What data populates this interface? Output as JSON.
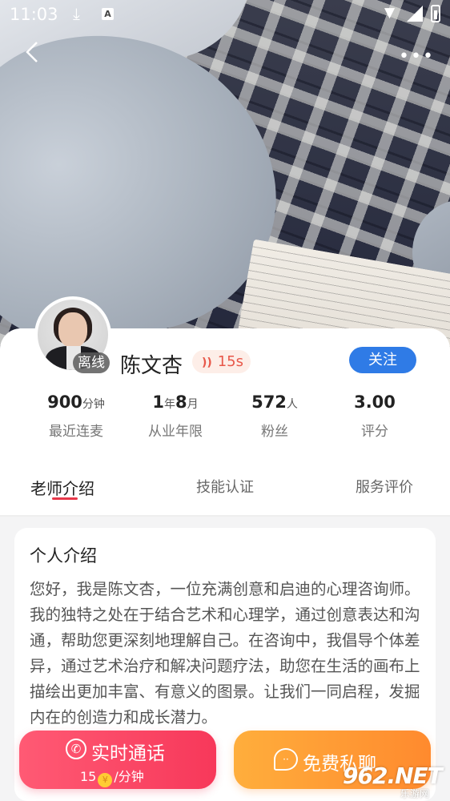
{
  "status_bar": {
    "time": "11:03",
    "download_icon": "download-icon",
    "accessibility_icon": "A"
  },
  "header": {
    "back_icon": "‹",
    "more_icon": "•••"
  },
  "profile": {
    "name": "陈文杏",
    "status": "离线",
    "voice_duration": "15s",
    "follow_label": "关注"
  },
  "stats": [
    {
      "value": "900",
      "unit": "分钟",
      "label": "最近连麦"
    },
    {
      "value": "1",
      "unit": "年",
      "value2": "8",
      "unit2": "月",
      "label": "从业年限"
    },
    {
      "value": "572",
      "unit": "人",
      "label": "粉丝"
    },
    {
      "value": "3.00",
      "unit": "",
      "label": "评分"
    }
  ],
  "tabs": [
    {
      "label": "老师介绍",
      "active": true
    },
    {
      "label": "技能认证",
      "active": false
    },
    {
      "label": "服务评价",
      "active": false
    }
  ],
  "intro": {
    "title": "个人介绍",
    "text": "您好，我是陈文杏，一位充满创意和启迪的心理咨询师。我的独特之处在于结合艺术和心理学，通过创意表达和沟通，帮助您更深刻地理解自己。在咨询中，我倡导个体差异，通过艺术治疗和解决问题疗法，助您在生活的画布上描绘出更加丰富、有意义的图景。让我们一同启程，发掘内在的创造力和成长潜力。"
  },
  "actions": {
    "call_label": "实时通话",
    "call_price_value": "15",
    "call_price_unit": "/分钟",
    "chat_label": "免费私聊"
  },
  "watermark": {
    "big": "962.NET",
    "small": "乐游网"
  },
  "colors": {
    "accent_red": "#f7385a",
    "accent_orange": "#ff8a2e",
    "follow_blue": "#2f7be6"
  }
}
